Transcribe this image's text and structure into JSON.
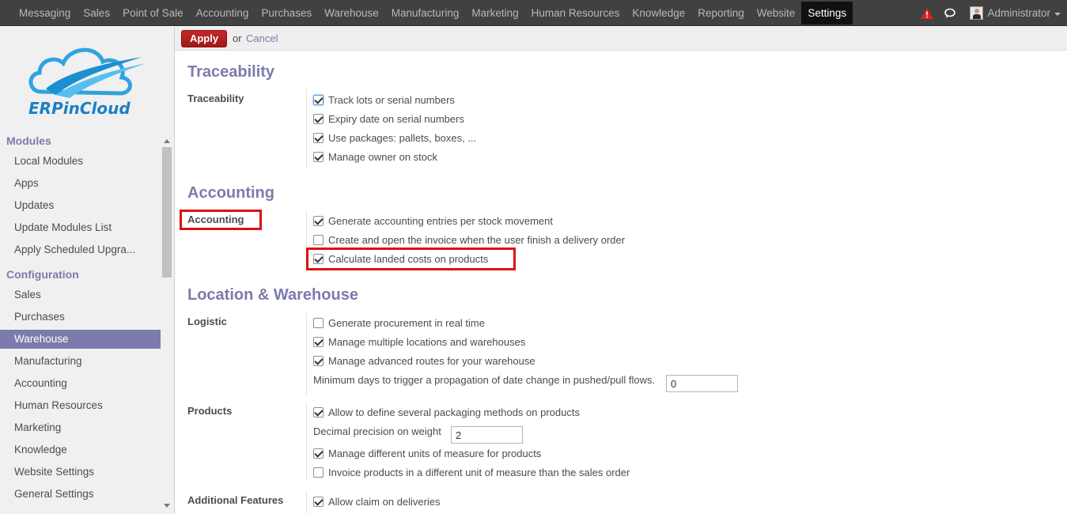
{
  "topbar": {
    "menu": [
      "Messaging",
      "Sales",
      "Point of Sale",
      "Accounting",
      "Purchases",
      "Warehouse",
      "Manufacturing",
      "Marketing",
      "Human Resources",
      "Knowledge",
      "Reporting",
      "Website",
      "Settings"
    ],
    "active": "Settings",
    "user": "Administrator"
  },
  "sidebar": {
    "logo_text": "ERPinCloud",
    "modules_title": "Modules",
    "modules": [
      "Local Modules",
      "Apps",
      "Updates",
      "Update Modules List",
      "Apply Scheduled Upgra..."
    ],
    "config_title": "Configuration",
    "config": [
      "Sales",
      "Purchases",
      "Warehouse",
      "Manufacturing",
      "Accounting",
      "Human Resources",
      "Marketing",
      "Knowledge",
      "Website Settings",
      "General Settings"
    ],
    "selected": "Warehouse"
  },
  "actions": {
    "apply": "Apply",
    "or": "or",
    "cancel": "Cancel"
  },
  "sections": {
    "traceability": {
      "heading": "Traceability",
      "label": "Traceability",
      "options": [
        {
          "text": "Track lots or serial numbers",
          "checked": true
        },
        {
          "text": "Expiry date on serial numbers",
          "checked": true
        },
        {
          "text": "Use packages: pallets, boxes, ...",
          "checked": true
        },
        {
          "text": "Manage owner on stock",
          "checked": true
        }
      ]
    },
    "accounting": {
      "heading": "Accounting",
      "label": "Accounting",
      "options": [
        {
          "text": "Generate accounting entries per stock movement",
          "checked": true
        },
        {
          "text": "Create and open the invoice when the user finish a delivery order",
          "checked": false
        },
        {
          "text": "Calculate landed costs on products",
          "checked": true
        }
      ]
    },
    "location": {
      "heading": "Location & Warehouse",
      "logistic_label": "Logistic",
      "logistic_options": [
        {
          "text": "Generate procurement in real time",
          "checked": false
        },
        {
          "text": "Manage multiple locations and warehouses",
          "checked": true
        },
        {
          "text": "Manage advanced routes for your warehouse",
          "checked": true
        }
      ],
      "min_days_label": "Minimum days to trigger a propagation of date change in pushed/pull flows.",
      "min_days_value": "0",
      "products_label": "Products",
      "packaging": {
        "text": "Allow to define several packaging methods on products",
        "checked": true
      },
      "decimal_label": "Decimal precision on weight",
      "decimal_value": "2",
      "uom": {
        "text": "Manage different units of measure for products",
        "checked": true
      },
      "invoice_uom": {
        "text": "Invoice products in a different unit of measure than the sales order",
        "checked": false
      },
      "additional_label": "Additional Features",
      "claim": {
        "text": "Allow claim on deliveries",
        "checked": true
      }
    }
  }
}
